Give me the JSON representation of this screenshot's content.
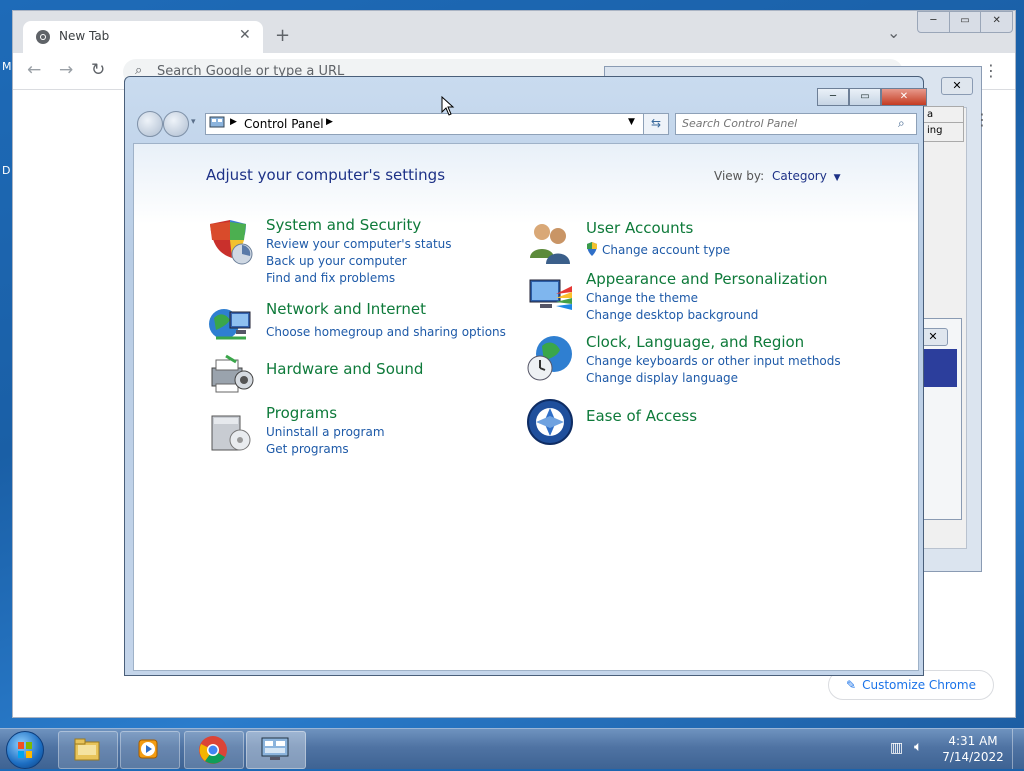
{
  "desktop": {
    "edge_letters": [
      "M",
      "D"
    ]
  },
  "chrome": {
    "tab_title": "New Tab",
    "tab_close": "✕",
    "new_tab": "+",
    "tab_search": "⌄",
    "omnibox_placeholder": "Search Google or type a URL",
    "customize_label": "Customize Chrome",
    "caption": {
      "minimize": "─",
      "maximize": "▭",
      "close": "✕"
    }
  },
  "background_dialog": {
    "close": "✕",
    "snippets": [
      "a",
      "ing"
    ]
  },
  "control_panel": {
    "caption": {
      "minimize": "─",
      "maximize": "▭",
      "close": "✕"
    },
    "breadcrumb": "Control Panel",
    "search_placeholder": "Search Control Panel",
    "heading": "Adjust your computer's settings",
    "view_by_label": "View by:",
    "view_by_value": "Category",
    "categories_left": [
      {
        "title": "System and Security",
        "icon": "shield-icon",
        "links": [
          "Review your computer's status",
          "Back up your computer",
          "Find and fix problems"
        ]
      },
      {
        "title": "Network and Internet",
        "icon": "network-globe-icon",
        "links": [
          "Choose homegroup and sharing options"
        ]
      },
      {
        "title": "Hardware and Sound",
        "icon": "printer-icon",
        "links": []
      },
      {
        "title": "Programs",
        "icon": "programs-box-icon",
        "links": [
          "Uninstall a program",
          "Get programs"
        ]
      }
    ],
    "categories_right": [
      {
        "title": "User Accounts",
        "icon": "users-icon",
        "links": [
          "Change account type"
        ]
      },
      {
        "title": "Appearance and Personalization",
        "icon": "monitor-paint-icon",
        "links": [
          "Change the theme",
          "Change desktop background"
        ]
      },
      {
        "title": "Clock, Language, and Region",
        "icon": "clock-globe-icon",
        "links": [
          "Change keyboards or other input methods",
          "Change display language"
        ]
      },
      {
        "title": "Ease of Access",
        "icon": "ease-of-access-icon",
        "links": []
      }
    ]
  },
  "taskbar": {
    "time": "4:31 AM",
    "date": "7/14/2022"
  }
}
